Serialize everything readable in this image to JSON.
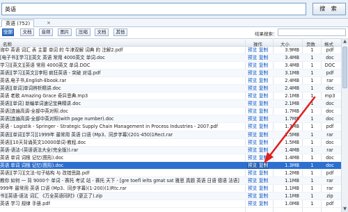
{
  "search": {
    "value": "英语",
    "button_label": "搜 索"
  },
  "tab": {
    "label": "英语 (752)",
    "close": "×"
  },
  "filters": {
    "buttons": [
      "全部",
      "文档",
      "音频",
      "图片",
      "压缩",
      "文档",
      "其他"
    ],
    "active_index": 0,
    "result_search_label": "结果搜索："
  },
  "columns": {
    "name": "名称",
    "action": "操作",
    "size": "大小",
    "pages": "页数",
    "format": "格式"
  },
  "actions": {
    "preview": "预览",
    "copy": "复制"
  },
  "rows": [
    {
      "name": "询中 英语 词汇 表 主要 单词 的 牛津双解 词典 的 注解2.pdf",
      "size": "3.9MB",
      "pages": "1",
      "format": "pdf"
    },
    {
      "name": "[电子书][学习][英文 英语 常用 4000英文 单词.doc",
      "size": "3.4MB",
      "pages": "1",
      "format": "doc"
    },
    {
      "name": "学习][英文][英语 常用 4000英文 单词.DOC",
      "size": "3.4MB",
      "pages": "1",
      "format": "DOC"
    },
    {
      "name": "英语][学习][英文][李阳 疯狂英语 - 突破 对话.pdf",
      "size": "3.1MB",
      "pages": "1",
      "format": "pdf"
    },
    {
      "name": "英语,电子书,English-Ebook.rar",
      "size": "2.4MB",
      "pages": "1",
      "format": "rar"
    },
    {
      "name": "英语][单词]单词辨析精讲.doc",
      "size": "2.4MB",
      "pages": "1",
      "format": "doc"
    },
    {
      "name": "英语 老歌 Amazing Grace 奇异恩典.mp3",
      "size": "2.1MB",
      "pages": "1",
      "format": "mp3"
    },
    {
      "name": "英语][单词] 新编单词速记宝典精讲.doc",
      "size": "2.1MB",
      "pages": "1",
      "format": "doc"
    },
    {
      "name": "英语]连遍高调-全部中英对照.doc",
      "size": "1.7MB",
      "pages": "1",
      "format": "doc"
    },
    {
      "name": "英语]连遍高调-全部中英对照(with page number).doc",
      "size": "1.7MB",
      "pages": "1",
      "format": "doc"
    },
    {
      "name": "英语 - Logistik - Springer - Strategic Supply Chain Management in Process Industries - 2007.pdf",
      "size": "1.7MB",
      "pages": "1",
      "format": "pdf"
    },
    {
      "name": "英语][单词][学习][1999年 最常用 英语 口语 (Mp3、同步字幕)(201-450)1Rect.rar",
      "size": "1.5MB",
      "pages": "1",
      "format": "rar"
    },
    {
      "name": "英语][10天背诵英文10000单词-教程.doc",
      "size": "1.5MB",
      "pages": "1",
      "format": "doc"
    },
    {
      "name": "英语-语法-(英语语法大全(完全版)).rar",
      "size": "1.4MB",
      "pages": "1",
      "format": "rar"
    },
    {
      "name": "英语 单词 词根 记忆(图形).doc",
      "size": "1.4MB",
      "pages": "1",
      "format": "doc"
    },
    {
      "name": "英语 单词 词根 记忆(图形).doc",
      "size": "1.3MB",
      "pages": "1",
      "format": "doc",
      "selected": true
    },
    {
      "name": "英语][学习][文法-句子结构 与 改错思路.pdf",
      "size": "1.2MB",
      "pages": "1",
      "format": "pdf"
    },
    {
      "name": "教你 如何 一 背 9000个 单词 - 赛托 考试 站 - 赛托 天下 - [gre toefl ielts gmat sat 雅思 真题 英语 日语 德语 法语]",
      "size": "1.1MB",
      "pages": "1",
      "format": "rar"
    },
    {
      "name": "999年 最常用 英语 口语 (Mp3、同步字幕)(1-200)(1)Rtc.rar",
      "size": "1.1MB",
      "pages": "1",
      "format": "rar"
    },
    {
      "name": "书][英语-语法 词汇 《万全英语同时》(更正了).zip",
      "size": "1.1MB",
      "pages": "1",
      "format": "zip"
    },
    {
      "name": "英语 学习 规律 手册.pdf",
      "size": "1.0MB",
      "pages": "1",
      "format": "pdf"
    }
  ],
  "scrollbar": {
    "up": "▲",
    "down": "▼"
  },
  "accent_color": "#2d6fcf",
  "arrow_color": "#e02020"
}
